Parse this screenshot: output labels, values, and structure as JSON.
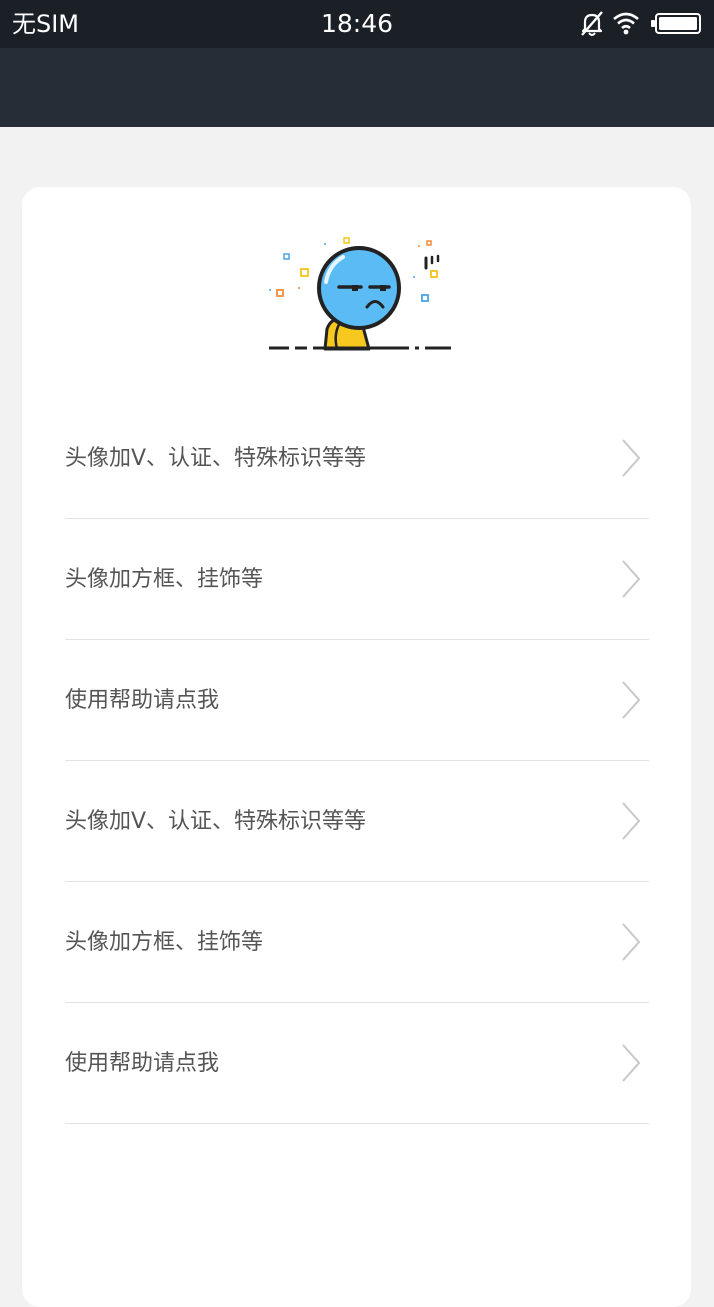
{
  "status_bar": {
    "carrier": "无SIM",
    "time": "18:46",
    "icons": [
      "bell-off-icon",
      "wifi-icon",
      "battery-icon"
    ]
  },
  "menu": {
    "items": [
      {
        "label": "头像加V、认证、特殊标识等等",
        "icon": "chevron-right-icon"
      },
      {
        "label": "头像加方框、挂饰等",
        "icon": "chevron-right-icon"
      },
      {
        "label": "使用帮助请点我",
        "icon": "chevron-right-icon"
      },
      {
        "label": "头像加V、认证、特殊标识等等",
        "icon": "chevron-right-icon"
      },
      {
        "label": "头像加方框、挂饰等",
        "icon": "chevron-right-icon"
      },
      {
        "label": "使用帮助请点我",
        "icon": "chevron-right-icon"
      }
    ]
  },
  "colors": {
    "status_bar_bg": "#1b2027",
    "header_bg": "#262d36",
    "page_bg": "#f2f2f2",
    "card_bg": "#ffffff",
    "text": "#555555",
    "divider": "#e3e3e3",
    "mascot_face": "#5bbcf5",
    "mascot_body": "#f7c81e"
  }
}
